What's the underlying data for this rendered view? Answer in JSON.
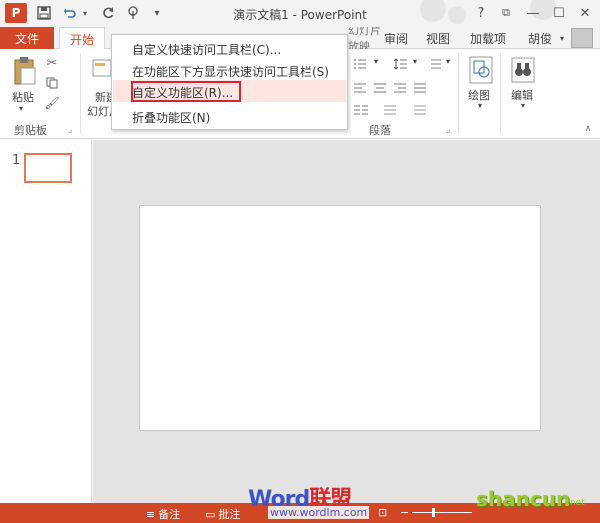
{
  "titlebar": {
    "app_logo": "P",
    "title": "演示文稿1 - PowerPoint",
    "qat_icons": [
      "save-icon",
      "undo-icon",
      "redo-icon",
      "touch-mode-icon",
      "customize-qat-icon"
    ],
    "window_buttons": [
      "?",
      "⧉",
      "—",
      "☐",
      "✕"
    ]
  },
  "tabs": {
    "file": "文件",
    "home": "开始",
    "others": [
      "审阅",
      "视图",
      "加载项"
    ],
    "partial_hidden": "幻灯片放映",
    "user": "胡俊"
  },
  "ribbon": {
    "clipboard": {
      "paste_label": "粘贴",
      "group_label": "剪贴板"
    },
    "slides": {
      "new_label_1": "新建",
      "new_label_2": "幻灯片"
    },
    "paragraph": {
      "group_label": "段落"
    },
    "drawing": {
      "label": "绘图"
    },
    "editing": {
      "label": "编辑"
    }
  },
  "qat_menu": {
    "items": [
      "自定义快速访问工具栏(C)...",
      "在功能区下方显示快速访问工具栏(S)",
      "自定义功能区(R)...",
      "折叠功能区(N)"
    ],
    "highlighted_index": 2
  },
  "thumbnails": {
    "slide_number": "1"
  },
  "statusbar": {
    "notes": "备注",
    "comments": "批注"
  },
  "watermarks": {
    "word_blue": "Word",
    "word_red": "联盟",
    "url": "www.wordlm.com",
    "shancun": "shancun",
    "shancun_net": ".net"
  },
  "colors": {
    "accent": "#d24726",
    "highlight_box": "#d5252d",
    "menu_hover": "#fde6e1"
  }
}
